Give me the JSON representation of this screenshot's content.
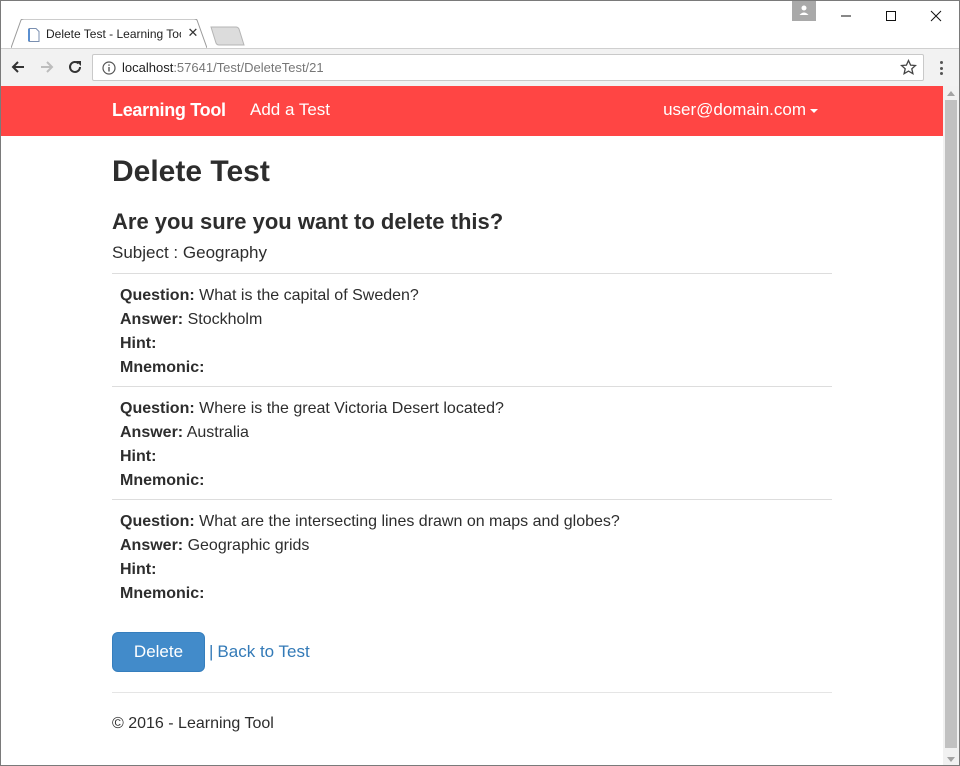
{
  "browser": {
    "tab_title": "Delete Test - Learning Tool",
    "url_host": "localhost",
    "url_path": ":57641/Test/DeleteTest/21"
  },
  "navbar": {
    "brand": "Learning Tool",
    "add_test": "Add a Test",
    "user": "user@domain.com"
  },
  "page": {
    "title": "Delete Test",
    "confirm": "Are you sure you want to delete this?",
    "subject_label": "Subject :",
    "subject_value": "Geography"
  },
  "labels": {
    "question": "Question:",
    "answer": "Answer:",
    "hint": "Hint:",
    "mnemonic": "Mnemonic:"
  },
  "questions": [
    {
      "question": "What is the capital of Sweden?",
      "answer": "Stockholm",
      "hint": "",
      "mnemonic": ""
    },
    {
      "question": "Where is the great Victoria Desert located?",
      "answer": "Australia",
      "hint": "",
      "mnemonic": ""
    },
    {
      "question": "What are the intersecting lines drawn on maps and globes?",
      "answer": "Geographic grids",
      "hint": "",
      "mnemonic": ""
    }
  ],
  "actions": {
    "delete": "Delete",
    "separator": "|",
    "back": "Back to Test"
  },
  "footer": "© 2016 - Learning Tool",
  "colors": {
    "navbar_bg": "#ff4544",
    "button_bg": "#428bca",
    "link": "#337ab7"
  }
}
